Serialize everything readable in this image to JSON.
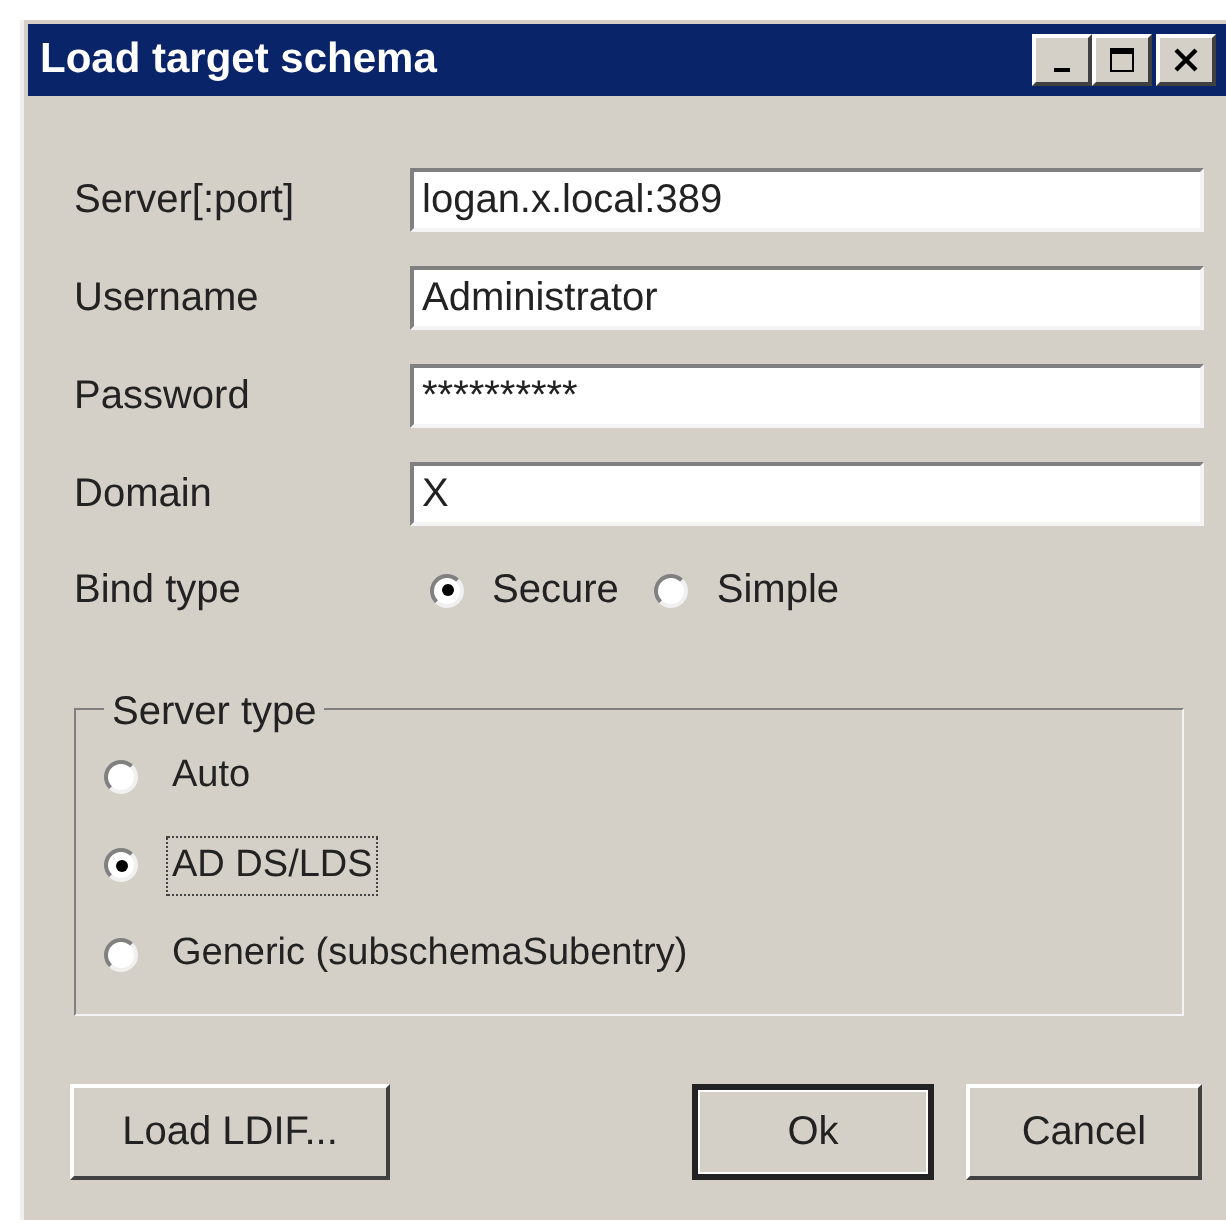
{
  "window": {
    "title": "Load target schema",
    "controls": [
      {
        "kind": "minimize"
      },
      {
        "kind": "maximize"
      },
      {
        "kind": "close"
      }
    ]
  },
  "fields": [
    {
      "label": "Server[:port]",
      "value": "logan.x.local:389"
    },
    {
      "label": "Username",
      "value": "Administrator"
    },
    {
      "label": "Password",
      "value": "**********"
    },
    {
      "label": "Domain",
      "value": "X"
    }
  ],
  "bind_type": {
    "label": "Bind type",
    "options": [
      {
        "label": "Secure",
        "selected": true
      },
      {
        "label": "Simple",
        "selected": false
      }
    ]
  },
  "server_type": {
    "title": "Server type",
    "options": [
      {
        "label": "Auto",
        "selected": false,
        "focused": false
      },
      {
        "label": "AD DS/LDS",
        "selected": true,
        "focused": true
      },
      {
        "label": "Generic (subschemaSubentry)",
        "selected": false,
        "focused": false
      }
    ]
  },
  "buttons": [
    {
      "label": "Load LDIF...",
      "default": false
    },
    {
      "label": "Ok",
      "default": true
    },
    {
      "label": "Cancel",
      "default": false
    }
  ]
}
